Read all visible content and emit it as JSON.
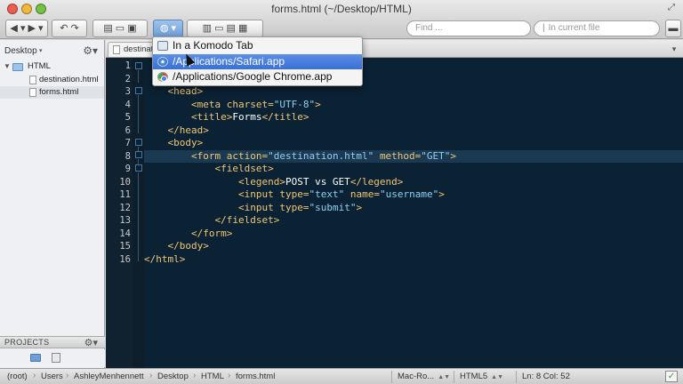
{
  "window": {
    "title": "forms.html (~/Desktop/HTML)"
  },
  "toolbar": {
    "find_placeholder": "Find ...",
    "scope_placeholder": "In current file"
  },
  "sidebar": {
    "places_label": "Desktop",
    "tree": [
      {
        "label": "HTML",
        "type": "folder"
      },
      {
        "label": "destination.html",
        "type": "file"
      },
      {
        "label": "forms.html",
        "type": "file",
        "selected": true
      }
    ],
    "projects_label": "PROJECTS"
  },
  "editor": {
    "tab_label": "destination.html",
    "line_numbers": [
      "1",
      "2",
      "3",
      "4",
      "5",
      "6",
      "7",
      "8",
      "9",
      "10",
      "11",
      "12",
      "13",
      "14",
      "15",
      "16"
    ],
    "current_line": 8
  },
  "browser_menu": {
    "items": [
      {
        "label": "In a Komodo Tab",
        "icon": "komodo-tab-icon"
      },
      {
        "label": "/Applications/Safari.app",
        "icon": "safari-icon",
        "highlighted": true
      },
      {
        "label": "/Applications/Google Chrome.app",
        "icon": "chrome-icon"
      }
    ]
  },
  "statusbar": {
    "breadcrumbs": [
      "(root)",
      "Users",
      "AshleyMenhennett",
      "Desktop",
      "HTML",
      "forms.html"
    ],
    "line_endings": "Mac-Ro...",
    "language": "HTML5",
    "position": "Ln: 8 Col: 52"
  },
  "colors": {
    "editor_background": "#0b2234",
    "tag": "#f0c674",
    "string": "#8fd0f0",
    "menu_highlight": "#3a6fd6"
  }
}
